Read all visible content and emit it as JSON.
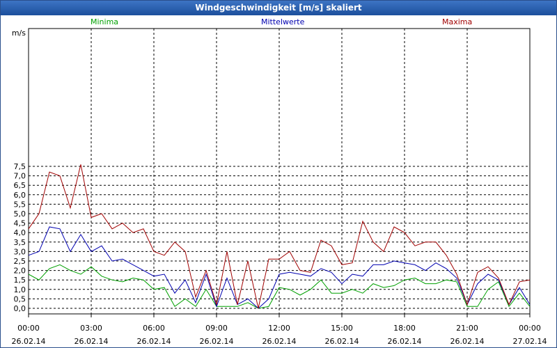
{
  "window": {
    "title": "Windgeschwindigkeit [m/s] skaliert"
  },
  "colors": {
    "minima": "#00a000",
    "mittel": "#0000b0",
    "maxima": "#a00000",
    "grid": "#000000"
  },
  "chart_data": {
    "type": "line",
    "title": "Windgeschwindigkeit [m/s] skaliert",
    "ylabel": "m/s",
    "ylim": [
      0,
      7.9
    ],
    "yticks": [
      0,
      0.5,
      1,
      1.5,
      2,
      2.5,
      3,
      3.5,
      4,
      4.5,
      5,
      5.5,
      6,
      6.5,
      7,
      7.5
    ],
    "ytick_labels": [
      "0,0",
      "0,5",
      "1,0",
      "1,5",
      "2,0",
      "2,5",
      "3,0",
      "3,5",
      "4,0",
      "4,5",
      "5,0",
      "5,5",
      "6,0",
      "6,5",
      "7,0",
      "7,5"
    ],
    "xlim": [
      0,
      24
    ],
    "xticks": [
      {
        "h": 0,
        "time": "00:00",
        "date": "26.02.14"
      },
      {
        "h": 3,
        "time": "03:00",
        "date": "26.02.14"
      },
      {
        "h": 6,
        "time": "06:00",
        "date": "26.02.14"
      },
      {
        "h": 9,
        "time": "09:00",
        "date": "26.02.14"
      },
      {
        "h": 12,
        "time": "12:00",
        "date": "26.02.14"
      },
      {
        "h": 15,
        "time": "15:00",
        "date": "26.02.14"
      },
      {
        "h": 18,
        "time": "18:00",
        "date": "26.02.14"
      },
      {
        "h": 21,
        "time": "21:00",
        "date": "26.02.14"
      },
      {
        "h": 24,
        "time": "00:00",
        "date": "27.02.14"
      }
    ],
    "grid": true,
    "legend_placement": "top",
    "x": [
      0,
      0.5,
      1,
      1.5,
      2,
      2.5,
      3,
      3.5,
      4,
      4.5,
      5,
      5.5,
      6,
      6.5,
      7,
      7.5,
      8,
      8.5,
      9,
      9.5,
      10,
      10.5,
      11,
      11.5,
      12,
      12.5,
      13,
      13.5,
      14,
      14.5,
      15,
      15.5,
      16,
      16.5,
      17,
      17.5,
      18,
      18.5,
      19,
      19.5,
      20,
      20.5,
      21,
      21.5,
      22,
      22.5,
      23,
      23.5,
      24
    ],
    "series": [
      {
        "name": "Minima",
        "color_key": "minima",
        "values": [
          1.8,
          1.5,
          2.1,
          2.3,
          2.0,
          1.8,
          2.2,
          1.7,
          1.5,
          1.4,
          1.6,
          1.5,
          1.0,
          1.1,
          0.1,
          0.5,
          0.1,
          1.0,
          0.1,
          0.1,
          0.1,
          0.3,
          0.0,
          0.1,
          1.1,
          1.0,
          0.7,
          1.0,
          1.5,
          0.8,
          0.8,
          1.0,
          0.8,
          1.3,
          1.1,
          1.2,
          1.5,
          1.6,
          1.3,
          1.3,
          1.5,
          1.4,
          0.1,
          0.1,
          1.0,
          1.4,
          0.1,
          0.8,
          0.1
        ]
      },
      {
        "name": "Mittelwerte",
        "color_key": "mittel",
        "values": [
          2.8,
          3.0,
          4.3,
          4.2,
          3.0,
          3.9,
          3.0,
          3.3,
          2.5,
          2.6,
          2.3,
          2.0,
          1.7,
          1.8,
          0.8,
          1.5,
          0.3,
          1.8,
          0.1,
          1.6,
          0.2,
          0.5,
          0.0,
          0.5,
          1.8,
          1.9,
          1.8,
          1.7,
          2.1,
          1.9,
          1.3,
          1.8,
          1.7,
          2.3,
          2.3,
          2.5,
          2.4,
          2.3,
          2.0,
          2.4,
          2.1,
          1.6,
          0.2,
          1.3,
          1.8,
          1.5,
          0.2,
          1.1,
          0.2
        ]
      },
      {
        "name": "Maxima",
        "color_key": "maxima",
        "values": [
          4.2,
          5.0,
          7.2,
          7.0,
          5.3,
          7.6,
          4.8,
          5.0,
          4.2,
          4.5,
          4.0,
          4.2,
          3.0,
          2.8,
          3.5,
          3.0,
          0.6,
          2.0,
          0.2,
          3.0,
          0.2,
          2.5,
          0.0,
          2.6,
          2.6,
          3.0,
          2.0,
          1.9,
          3.6,
          3.3,
          2.3,
          2.4,
          4.6,
          3.5,
          3.0,
          4.3,
          4.0,
          3.3,
          3.5,
          3.5,
          2.8,
          1.8,
          0.2,
          1.9,
          2.2,
          1.6,
          0.2,
          1.4,
          1.5
        ]
      }
    ]
  }
}
